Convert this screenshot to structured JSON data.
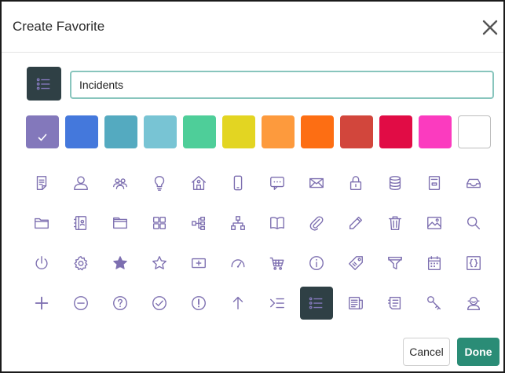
{
  "dialog": {
    "title": "Create Favorite",
    "close_icon": "close-icon"
  },
  "name_input": {
    "value": "Incidents",
    "preview_icon": "list-icon"
  },
  "colors": [
    {
      "hex": "#8378bb",
      "selected": true
    },
    {
      "hex": "#4478dc",
      "selected": false
    },
    {
      "hex": "#54aac0",
      "selected": false
    },
    {
      "hex": "#78c4d4",
      "selected": false
    },
    {
      "hex": "#4ece99",
      "selected": false
    },
    {
      "hex": "#e3d522",
      "selected": false
    },
    {
      "hex": "#fd9a3d",
      "selected": false
    },
    {
      "hex": "#fd6e13",
      "selected": false
    },
    {
      "hex": "#d2463c",
      "selected": false
    },
    {
      "hex": "#e10c45",
      "selected": false
    },
    {
      "hex": "#fb3bbf",
      "selected": false
    },
    {
      "hex": "#ffffff",
      "selected": false
    }
  ],
  "icons": [
    [
      "document-icon",
      "user-icon",
      "users-icon",
      "lightbulb-icon",
      "home-icon",
      "mobile-icon",
      "chat-icon",
      "mail-icon",
      "lock-icon",
      "database-icon",
      "form-icon",
      "inbox-icon"
    ],
    [
      "folder-icon",
      "phone-book-icon",
      "folder-tab-icon",
      "grid-icon",
      "workflow-icon",
      "hierarchy-icon",
      "book-icon",
      "paperclip-icon",
      "pencil-icon",
      "trash-icon",
      "image-icon",
      "search-icon"
    ],
    [
      "power-icon",
      "gear-icon",
      "star-filled-icon",
      "star-outline-icon",
      "plus-box-icon",
      "speedometer-icon",
      "cart-icon",
      "info-icon",
      "tag-icon",
      "filter-icon",
      "calendar-icon",
      "braces-icon"
    ],
    [
      "plus-icon",
      "minus-circle-icon",
      "question-icon",
      "check-circle-icon",
      "alert-icon",
      "arrow-up-icon",
      "indent-icon",
      "list-icon",
      "news-icon",
      "feed-icon",
      "key-icon",
      "agent-icon"
    ]
  ],
  "selected_icon": "list-icon",
  "icon_color": "#7d6fb0",
  "buttons": {
    "cancel": "Cancel",
    "done": "Done"
  }
}
